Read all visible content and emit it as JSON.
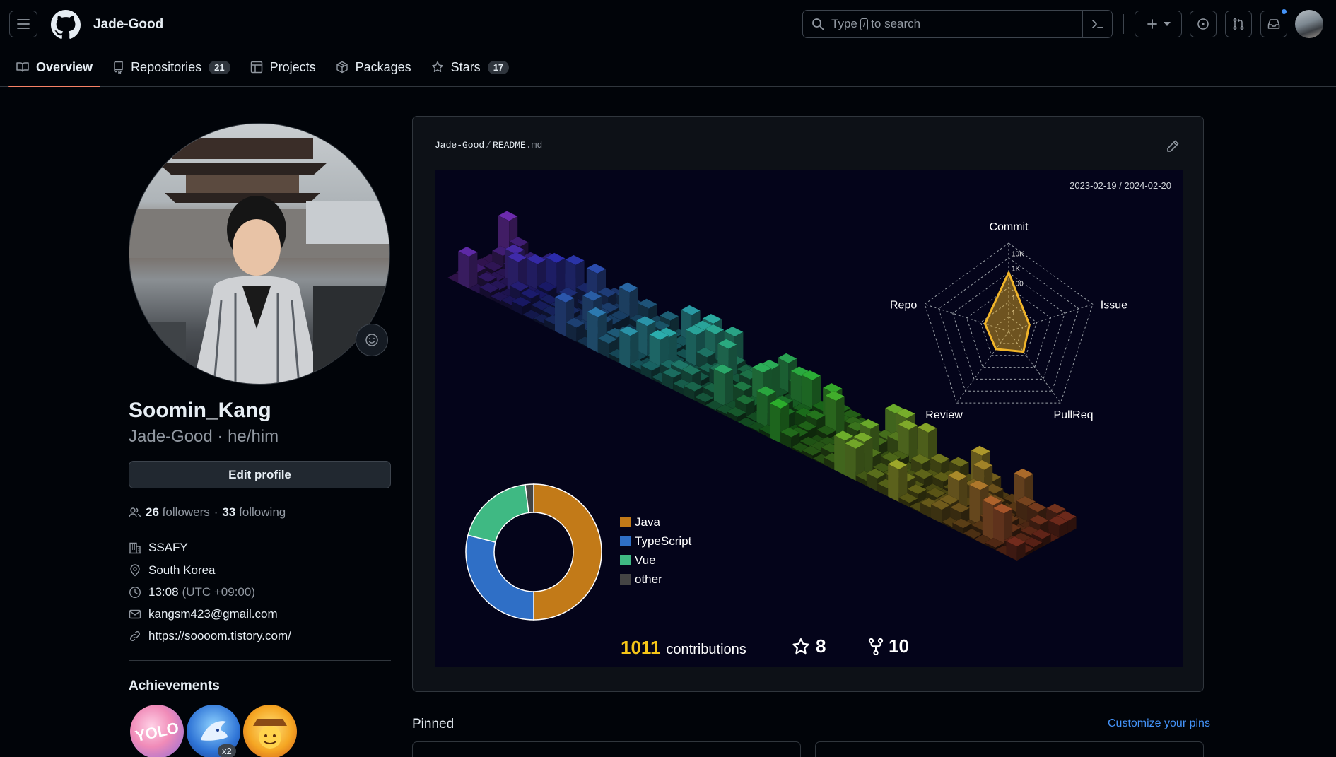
{
  "header": {
    "owner": "Jade-Good",
    "search": {
      "prefix": "Type",
      "key": "/",
      "suffix": "to search"
    }
  },
  "tabs": [
    {
      "label": "Overview",
      "count": null,
      "icon": "book-icon",
      "active": true
    },
    {
      "label": "Repositories",
      "count": "21",
      "icon": "repo-icon",
      "active": false
    },
    {
      "label": "Projects",
      "count": null,
      "icon": "table-icon",
      "active": false
    },
    {
      "label": "Packages",
      "count": null,
      "icon": "package-icon",
      "active": false
    },
    {
      "label": "Stars",
      "count": "17",
      "icon": "star-icon",
      "active": false
    }
  ],
  "profile": {
    "full_name": "Soomin_Kang",
    "login_line": "Jade-Good · he/him",
    "edit_label": "Edit profile",
    "followers_count": "26",
    "followers_label": "followers",
    "dot": "·",
    "following_count": "33",
    "following_label": "following",
    "company": "SSAFY",
    "location": "South Korea",
    "time": "13:08",
    "timezone": "(UTC +09:00)",
    "email": "kangsm423@gmail.com",
    "website": "https://soooom.tistory.com/",
    "achievements_title": "Achievements",
    "badge_multiplier": "x2"
  },
  "readme": {
    "owner": "Jade-Good",
    "separator": "/",
    "file_name": "README",
    "file_ext": ".md",
    "date_range": "2023-02-19 / 2024-02-20",
    "contributions_count": "1011",
    "contributions_label": "contributions",
    "stars": "8",
    "forks": "10"
  },
  "pinned": {
    "title": "Pinned",
    "customize": "Customize your pins"
  },
  "colors": {
    "accent_tab": "#f78166",
    "link": "#4493f8",
    "radar_fill": "#f0b429",
    "contrib_number": "#f5c518"
  },
  "chart_data": [
    {
      "type": "pie",
      "variant": "donut",
      "title": "",
      "categories": [
        "Java",
        "TypeScript",
        "Vue",
        "other"
      ],
      "values": [
        50,
        29,
        19,
        2
      ],
      "colors": [
        "#c27a18",
        "#2f6fc6",
        "#3fb983",
        "#444444"
      ],
      "legend": "right"
    },
    {
      "type": "radar",
      "title": "",
      "axes": [
        "Commit",
        "Issue",
        "PullReq",
        "Review",
        "Repo"
      ],
      "scale": "log",
      "scale_ticks": [
        "1",
        "10",
        "100",
        "1K",
        "10K"
      ],
      "values": [
        1000,
        3,
        5,
        3,
        5
      ],
      "grid": true
    }
  ]
}
